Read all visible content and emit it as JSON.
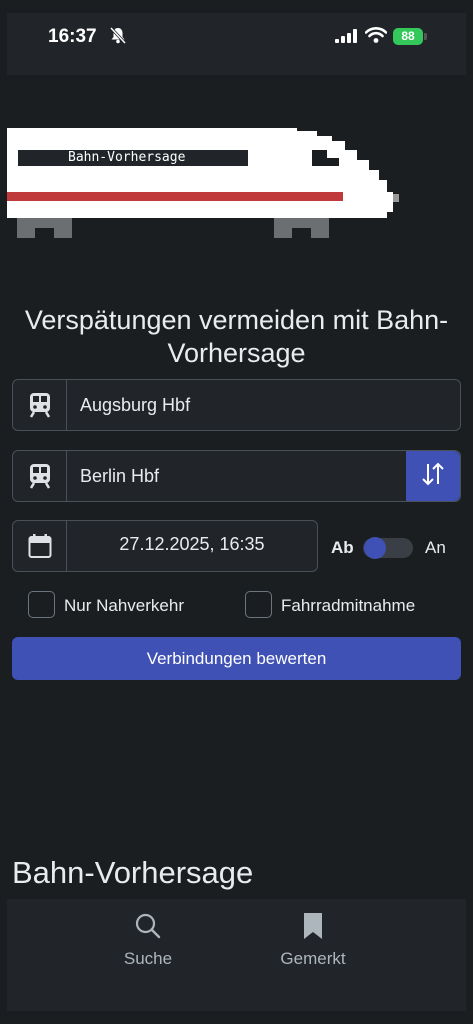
{
  "status": {
    "time": "16:37",
    "battery": "88"
  },
  "hero": {
    "train_label": "Bahn-Vorhersage"
  },
  "headline": {
    "line1": "Verspätungen vermeiden mit Bahn-",
    "line2": "Vorhersage"
  },
  "form": {
    "from_value": "Augsburg Hbf",
    "to_value": "Berlin Hbf",
    "datetime": "27.12.2025, 16:35",
    "ab_label": "Ab",
    "an_label": "An",
    "nahverkehr_label": "Nur Nahverkehr",
    "fahrrad_label": "Fahrradmitnahme",
    "submit_label": "Verbindungen bewerten"
  },
  "footer": {
    "title": "Bahn-Vorhersage"
  },
  "tabs": [
    {
      "label": "Suche",
      "icon": "search-icon"
    },
    {
      "label": "Gemerkt",
      "icon": "bookmark-icon"
    }
  ],
  "colors": {
    "accent": "#3f51b5",
    "background": "#1b1e21",
    "stripe": "#c0393b"
  }
}
